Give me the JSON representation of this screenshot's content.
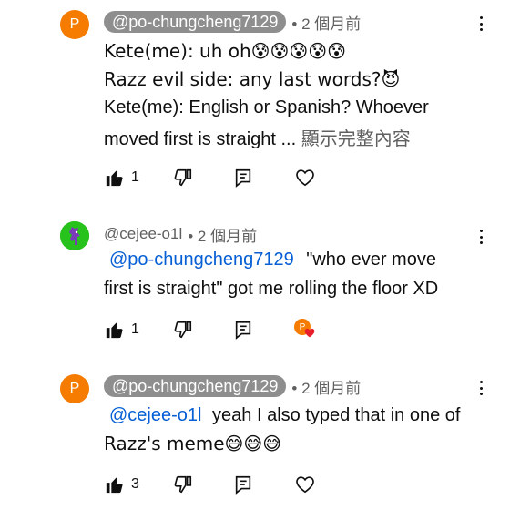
{
  "comments": [
    {
      "avatar_letter": "P",
      "author": "@po-chungcheng7129",
      "meta": "• 2 個月前",
      "lines": [
        "Kete(me): uh oh😰😰😰😰😰",
        "Razz evil side: any last words?😈",
        "Kete(me): English or Spanish? Whoever",
        "moved first is straight ..."
      ],
      "show_more": "顯示完整內容",
      "likes": "1"
    },
    {
      "author": "@cejee-o1l",
      "meta": "• 2 個月前",
      "mention": "@po-chungcheng7129",
      "line1_rest": "\"who ever move",
      "line2": "first is straight\" got me rolling the floor XD",
      "likes": "1",
      "creator_heart_letter": "P"
    },
    {
      "avatar_letter": "P",
      "author": "@po-chungcheng7129",
      "meta": "• 2 個月前",
      "mention": "@cejee-o1l",
      "line1_rest": "yeah I also typed that in one of",
      "line2": "Razz's meme😅😅😅",
      "likes": "3"
    }
  ],
  "icons": {
    "like": "thumbs-up-icon",
    "dislike": "thumbs-down-icon",
    "reply": "reply-icon",
    "heart": "heart-icon",
    "more": "more-vert-icon"
  },
  "colors": {
    "mention": "#065fd4",
    "avatar_orange": "#f57c00",
    "avatar_green": "#28c21c"
  }
}
